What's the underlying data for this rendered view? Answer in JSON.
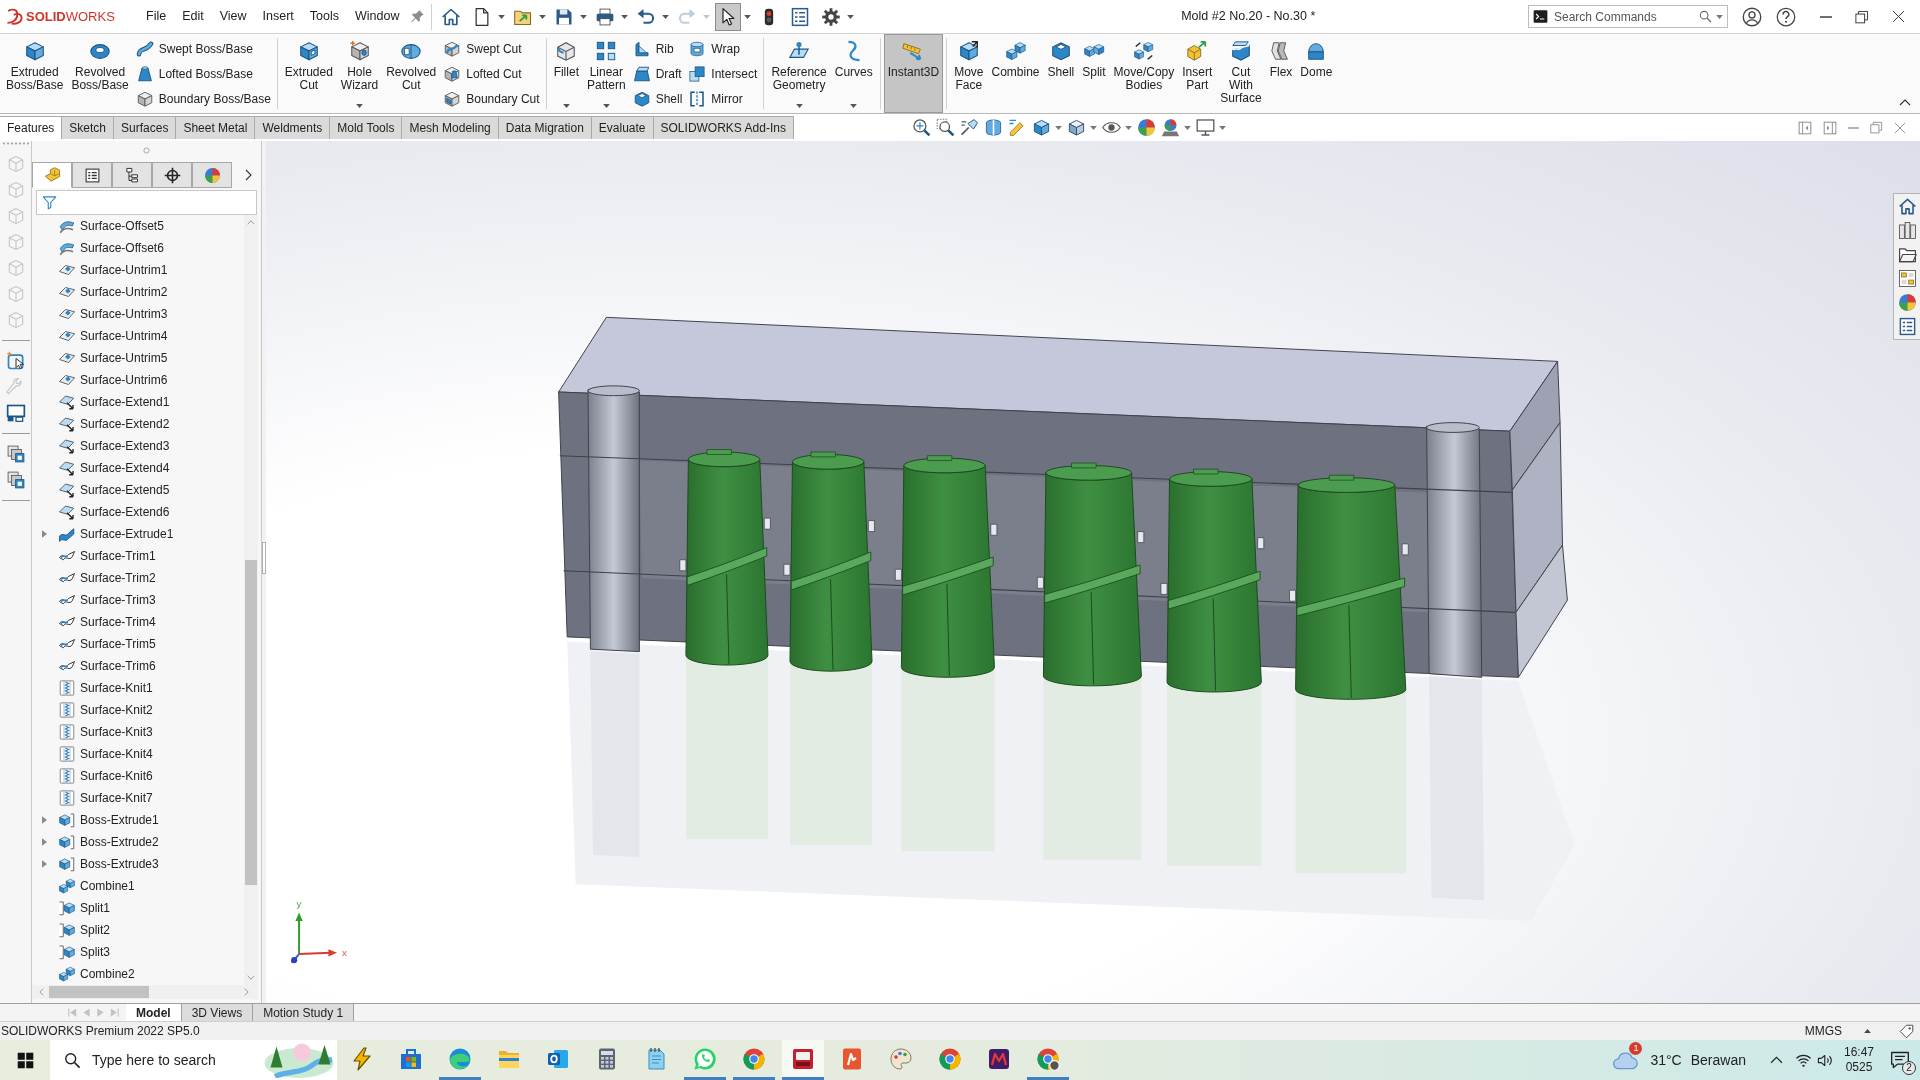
{
  "app": {
    "logo": "**SOLID**WORKS"
  },
  "menu": [
    "File",
    "Edit",
    "View",
    "Insert",
    "Tools",
    "Window"
  ],
  "quick_access": [
    {
      "dropdown": false,
      "pressed": false,
      "disabled": false
    },
    {
      "dropdown": true,
      "pressed": false,
      "disabled": false
    },
    {
      "dropdown": true,
      "pressed": false,
      "disabled": false
    },
    {
      "dropdown": true,
      "pressed": false,
      "disabled": false
    },
    {
      "dropdown": true,
      "pressed": false,
      "disabled": false
    },
    {
      "dropdown": true,
      "pressed": false,
      "disabled": false
    },
    {
      "dropdown": true,
      "pressed": false,
      "disabled": true
    },
    {
      "dropdown": true,
      "pressed": true,
      "disabled": false
    },
    {
      "dropdown": false,
      "pressed": false,
      "disabled": false
    },
    {
      "dropdown": false,
      "pressed": false,
      "disabled": false
    },
    {
      "dropdown": true,
      "pressed": false,
      "disabled": false
    }
  ],
  "window": {
    "title": "Mold #2 No.20 - No.30 *"
  },
  "search": {
    "placeholder": "Search Commands"
  },
  "ribbon": {
    "groups": [
      {
        "items": [
          {
            "kind": "large",
            "label": "Extruded\nBoss/Base",
            "dropdown": false,
            "pressed": false
          },
          {
            "kind": "large",
            "label": "Revolved\nBoss/Base",
            "dropdown": false,
            "pressed": false
          },
          {
            "kind": "stack",
            "items": [
              "Swept Boss/Base",
              "Lofted Boss/Base",
              "Boundary Boss/Base"
            ]
          }
        ]
      },
      {
        "items": [
          {
            "kind": "large",
            "label": "Extruded\nCut",
            "dropdown": false,
            "pressed": false
          },
          {
            "kind": "large",
            "label": "Hole\nWizard",
            "dropdown": true,
            "pressed": false
          },
          {
            "kind": "large",
            "label": "Revolved\nCut",
            "dropdown": false,
            "pressed": false
          },
          {
            "kind": "stack",
            "items": [
              "Swept Cut",
              "Lofted Cut",
              "Boundary Cut"
            ]
          }
        ]
      },
      {
        "items": [
          {
            "kind": "large",
            "label": "Fillet",
            "dropdown": true,
            "pressed": false
          },
          {
            "kind": "large",
            "label": "Linear\nPattern",
            "dropdown": true,
            "pressed": false
          },
          {
            "kind": "stack",
            "items": [
              "Rib",
              "Draft",
              "Shell"
            ]
          },
          {
            "kind": "stack",
            "items": [
              "Wrap",
              "Intersect",
              "Mirror"
            ]
          }
        ]
      },
      {
        "items": [
          {
            "kind": "large",
            "label": "Reference\nGeometry",
            "dropdown": true,
            "pressed": false
          },
          {
            "kind": "large",
            "label": "Curves",
            "dropdown": true,
            "pressed": false
          }
        ]
      },
      {
        "items": [
          {
            "kind": "large",
            "label": "Instant3D",
            "dropdown": false,
            "pressed": true
          }
        ]
      },
      {
        "items": [
          {
            "kind": "large",
            "label": "Move\nFace",
            "dropdown": false,
            "pressed": false
          },
          {
            "kind": "large",
            "label": "Combine",
            "dropdown": false,
            "pressed": false
          },
          {
            "kind": "large",
            "label": "Shell",
            "dropdown": false,
            "pressed": false
          },
          {
            "kind": "large",
            "label": "Split",
            "dropdown": false,
            "pressed": false
          },
          {
            "kind": "large",
            "label": "Move/Copy\nBodies",
            "dropdown": false,
            "pressed": false
          },
          {
            "kind": "large",
            "label": "Insert\nPart",
            "dropdown": false,
            "pressed": false
          },
          {
            "kind": "large",
            "label": "Cut\nWith\nSurface",
            "dropdown": false,
            "pressed": false
          },
          {
            "kind": "large",
            "label": "Flex",
            "dropdown": false,
            "pressed": false
          },
          {
            "kind": "large",
            "label": "Dome",
            "dropdown": false,
            "pressed": false
          }
        ]
      }
    ]
  },
  "command_tabs": [
    {
      "label": "Features",
      "selected": true
    },
    {
      "label": "Sketch",
      "selected": false
    },
    {
      "label": "Surfaces",
      "selected": false
    },
    {
      "label": "Sheet Metal",
      "selected": false
    },
    {
      "label": "Weldments",
      "selected": false
    },
    {
      "label": "Mold Tools",
      "selected": false
    },
    {
      "label": "Mesh Modeling",
      "selected": false
    },
    {
      "label": "Data Migration",
      "selected": false
    },
    {
      "label": "Evaluate",
      "selected": false
    },
    {
      "label": "SOLIDWORKS Add-Ins",
      "selected": false
    }
  ],
  "side_toolbar": [
    [
      {
        "disabled": true
      },
      {
        "disabled": true
      },
      {
        "disabled": true
      },
      {
        "disabled": true
      },
      {
        "disabled": true
      },
      {
        "disabled": true
      },
      {
        "disabled": true
      }
    ],
    [
      {
        "disabled": false
      },
      {
        "disabled": true
      },
      {
        "disabled": false
      }
    ],
    [
      {
        "disabled": false
      },
      {
        "disabled": false
      }
    ]
  ],
  "panel_tabs": [
    {
      "selected": true
    },
    {
      "selected": false
    },
    {
      "selected": false
    },
    {
      "selected": false
    },
    {
      "selected": false
    }
  ],
  "feature_tree": [
    {
      "label": "Surface-Offset5",
      "kind": "offset",
      "has_children": false
    },
    {
      "label": "Surface-Offset6",
      "kind": "offset",
      "has_children": false
    },
    {
      "label": "Surface-Untrim1",
      "kind": "untrim",
      "has_children": false
    },
    {
      "label": "Surface-Untrim2",
      "kind": "untrim",
      "has_children": false
    },
    {
      "label": "Surface-Untrim3",
      "kind": "untrim",
      "has_children": false
    },
    {
      "label": "Surface-Untrim4",
      "kind": "untrim",
      "has_children": false
    },
    {
      "label": "Surface-Untrim5",
      "kind": "untrim",
      "has_children": false
    },
    {
      "label": "Surface-Untrim6",
      "kind": "untrim",
      "has_children": false
    },
    {
      "label": "Surface-Extend1",
      "kind": "extend",
      "has_children": false
    },
    {
      "label": "Surface-Extend2",
      "kind": "extend",
      "has_children": false
    },
    {
      "label": "Surface-Extend3",
      "kind": "extend",
      "has_children": false
    },
    {
      "label": "Surface-Extend4",
      "kind": "extend",
      "has_children": false
    },
    {
      "label": "Surface-Extend5",
      "kind": "extend",
      "has_children": false
    },
    {
      "label": "Surface-Extend6",
      "kind": "extend",
      "has_children": false
    },
    {
      "label": "Surface-Extrude1",
      "kind": "surface_extrude",
      "has_children": true
    },
    {
      "label": "Surface-Trim1",
      "kind": "trim",
      "has_children": false
    },
    {
      "label": "Surface-Trim2",
      "kind": "trim",
      "has_children": false
    },
    {
      "label": "Surface-Trim3",
      "kind": "trim",
      "has_children": false
    },
    {
      "label": "Surface-Trim4",
      "kind": "trim",
      "has_children": false
    },
    {
      "label": "Surface-Trim5",
      "kind": "trim",
      "has_children": false
    },
    {
      "label": "Surface-Trim6",
      "kind": "trim",
      "has_children": false
    },
    {
      "label": "Surface-Knit1",
      "kind": "knit",
      "has_children": false
    },
    {
      "label": "Surface-Knit2",
      "kind": "knit",
      "has_children": false
    },
    {
      "label": "Surface-Knit3",
      "kind": "knit",
      "has_children": false
    },
    {
      "label": "Surface-Knit4",
      "kind": "knit",
      "has_children": false
    },
    {
      "label": "Surface-Knit6",
      "kind": "knit",
      "has_children": false
    },
    {
      "label": "Surface-Knit7",
      "kind": "knit",
      "has_children": false
    },
    {
      "label": "Boss-Extrude1",
      "kind": "boss",
      "has_children": true
    },
    {
      "label": "Boss-Extrude2",
      "kind": "boss",
      "has_children": true
    },
    {
      "label": "Boss-Extrude3",
      "kind": "boss",
      "has_children": true
    },
    {
      "label": "Combine1",
      "kind": "combine",
      "has_children": false
    },
    {
      "label": "Split1",
      "kind": "split",
      "has_children": false
    },
    {
      "label": "Split2",
      "kind": "split",
      "has_children": false
    },
    {
      "label": "Split3",
      "kind": "split",
      "has_children": false
    },
    {
      "label": "Combine2",
      "kind": "combine",
      "has_children": false
    }
  ],
  "axis_triad": {
    "x_label": "x",
    "y_label": "y"
  },
  "bottom_tabs": [
    {
      "label": "Model",
      "selected": true
    },
    {
      "label": "3D Views",
      "selected": false
    },
    {
      "label": "Motion Study 1",
      "selected": false
    }
  ],
  "status_bar": {
    "text": "SOLIDWORKS Premium 2022 SP5.0",
    "units": "MMGS"
  },
  "taskbar": {
    "search": {
      "placeholder": "Type here to search"
    },
    "apps": [
      {
        "running": false,
        "active": false
      },
      {
        "running": false,
        "active": false
      },
      {
        "running": true,
        "active": false
      },
      {
        "running": false,
        "active": false
      },
      {
        "running": false,
        "active": false
      },
      {
        "running": false,
        "active": false
      },
      {
        "running": false,
        "active": false
      },
      {
        "running": true,
        "active": false
      },
      {
        "running": true,
        "active": false
      },
      {
        "running": true,
        "active": true
      },
      {
        "running": false,
        "active": false
      },
      {
        "running": false,
        "active": false
      },
      {
        "running": false,
        "active": false
      },
      {
        "running": false,
        "active": false
      },
      {
        "running": true,
        "active": false
      }
    ],
    "weather": {
      "alerts": "1",
      "temperature": "31°C",
      "condition": "Berawan"
    },
    "clock": {
      "time": "16:47",
      "date": "0525"
    },
    "notifications": "2"
  }
}
